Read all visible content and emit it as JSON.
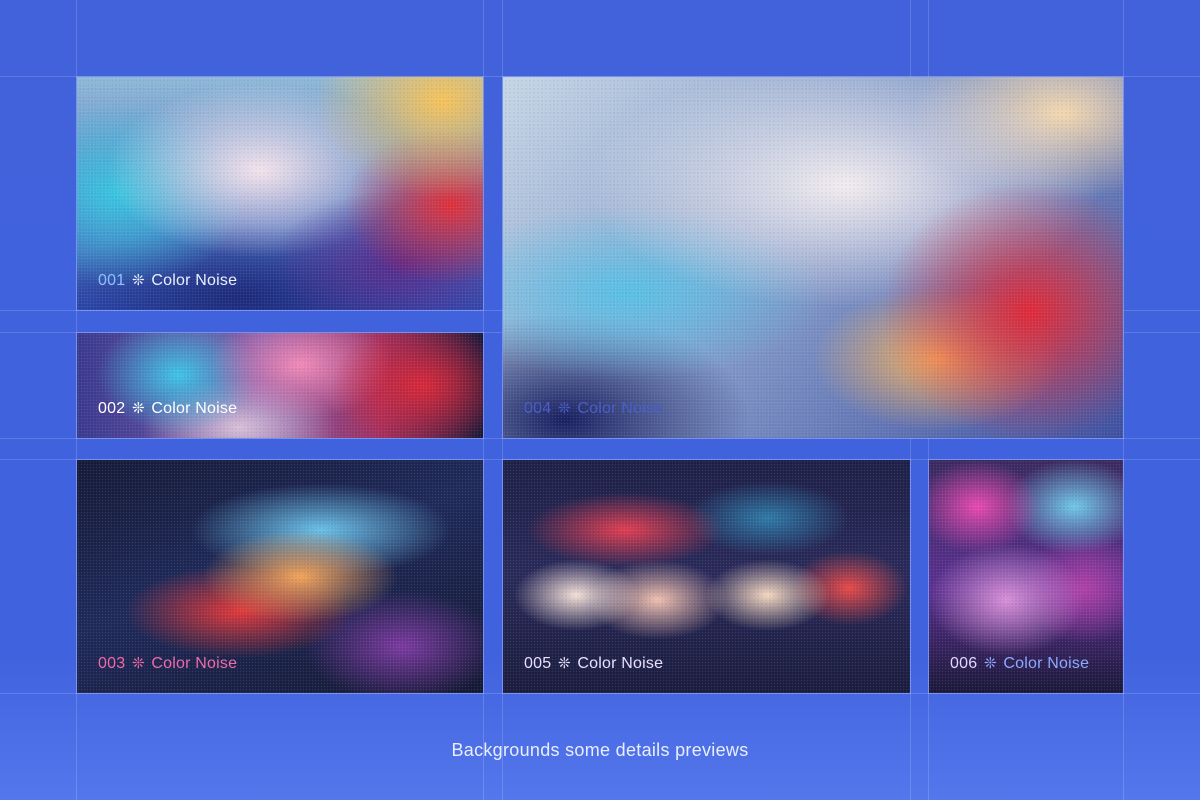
{
  "tiles": [
    {
      "number": "001",
      "separator": "❊",
      "name": "Color Noise",
      "label_color": "#e8f0ff",
      "number_color": "#8fc0ff"
    },
    {
      "number": "002",
      "separator": "❊",
      "name": "Color Noise",
      "label_color": "#ffffff",
      "number_color": "#ffffff"
    },
    {
      "number": "003",
      "separator": "❊",
      "name": "Color Noise",
      "label_color": "#f06aa8",
      "number_color": "#f06aa8"
    },
    {
      "number": "004",
      "separator": "❊",
      "name": "Color Noise",
      "label_color": "#4a5ec8",
      "number_color": "#4a5ec8"
    },
    {
      "number": "005",
      "separator": "❊",
      "name": "Color Noise",
      "label_color": "#e8e0ff",
      "number_color": "#e8e0ff"
    },
    {
      "number": "006",
      "separator": "❊",
      "name": "Color Noise",
      "label_color": "#8ea8ff",
      "number_color": "#e0d8ff"
    }
  ],
  "caption": "Backgrounds some details previews",
  "colors": {
    "background": "#4262dc",
    "guide_lines": "#c8d7ff"
  }
}
